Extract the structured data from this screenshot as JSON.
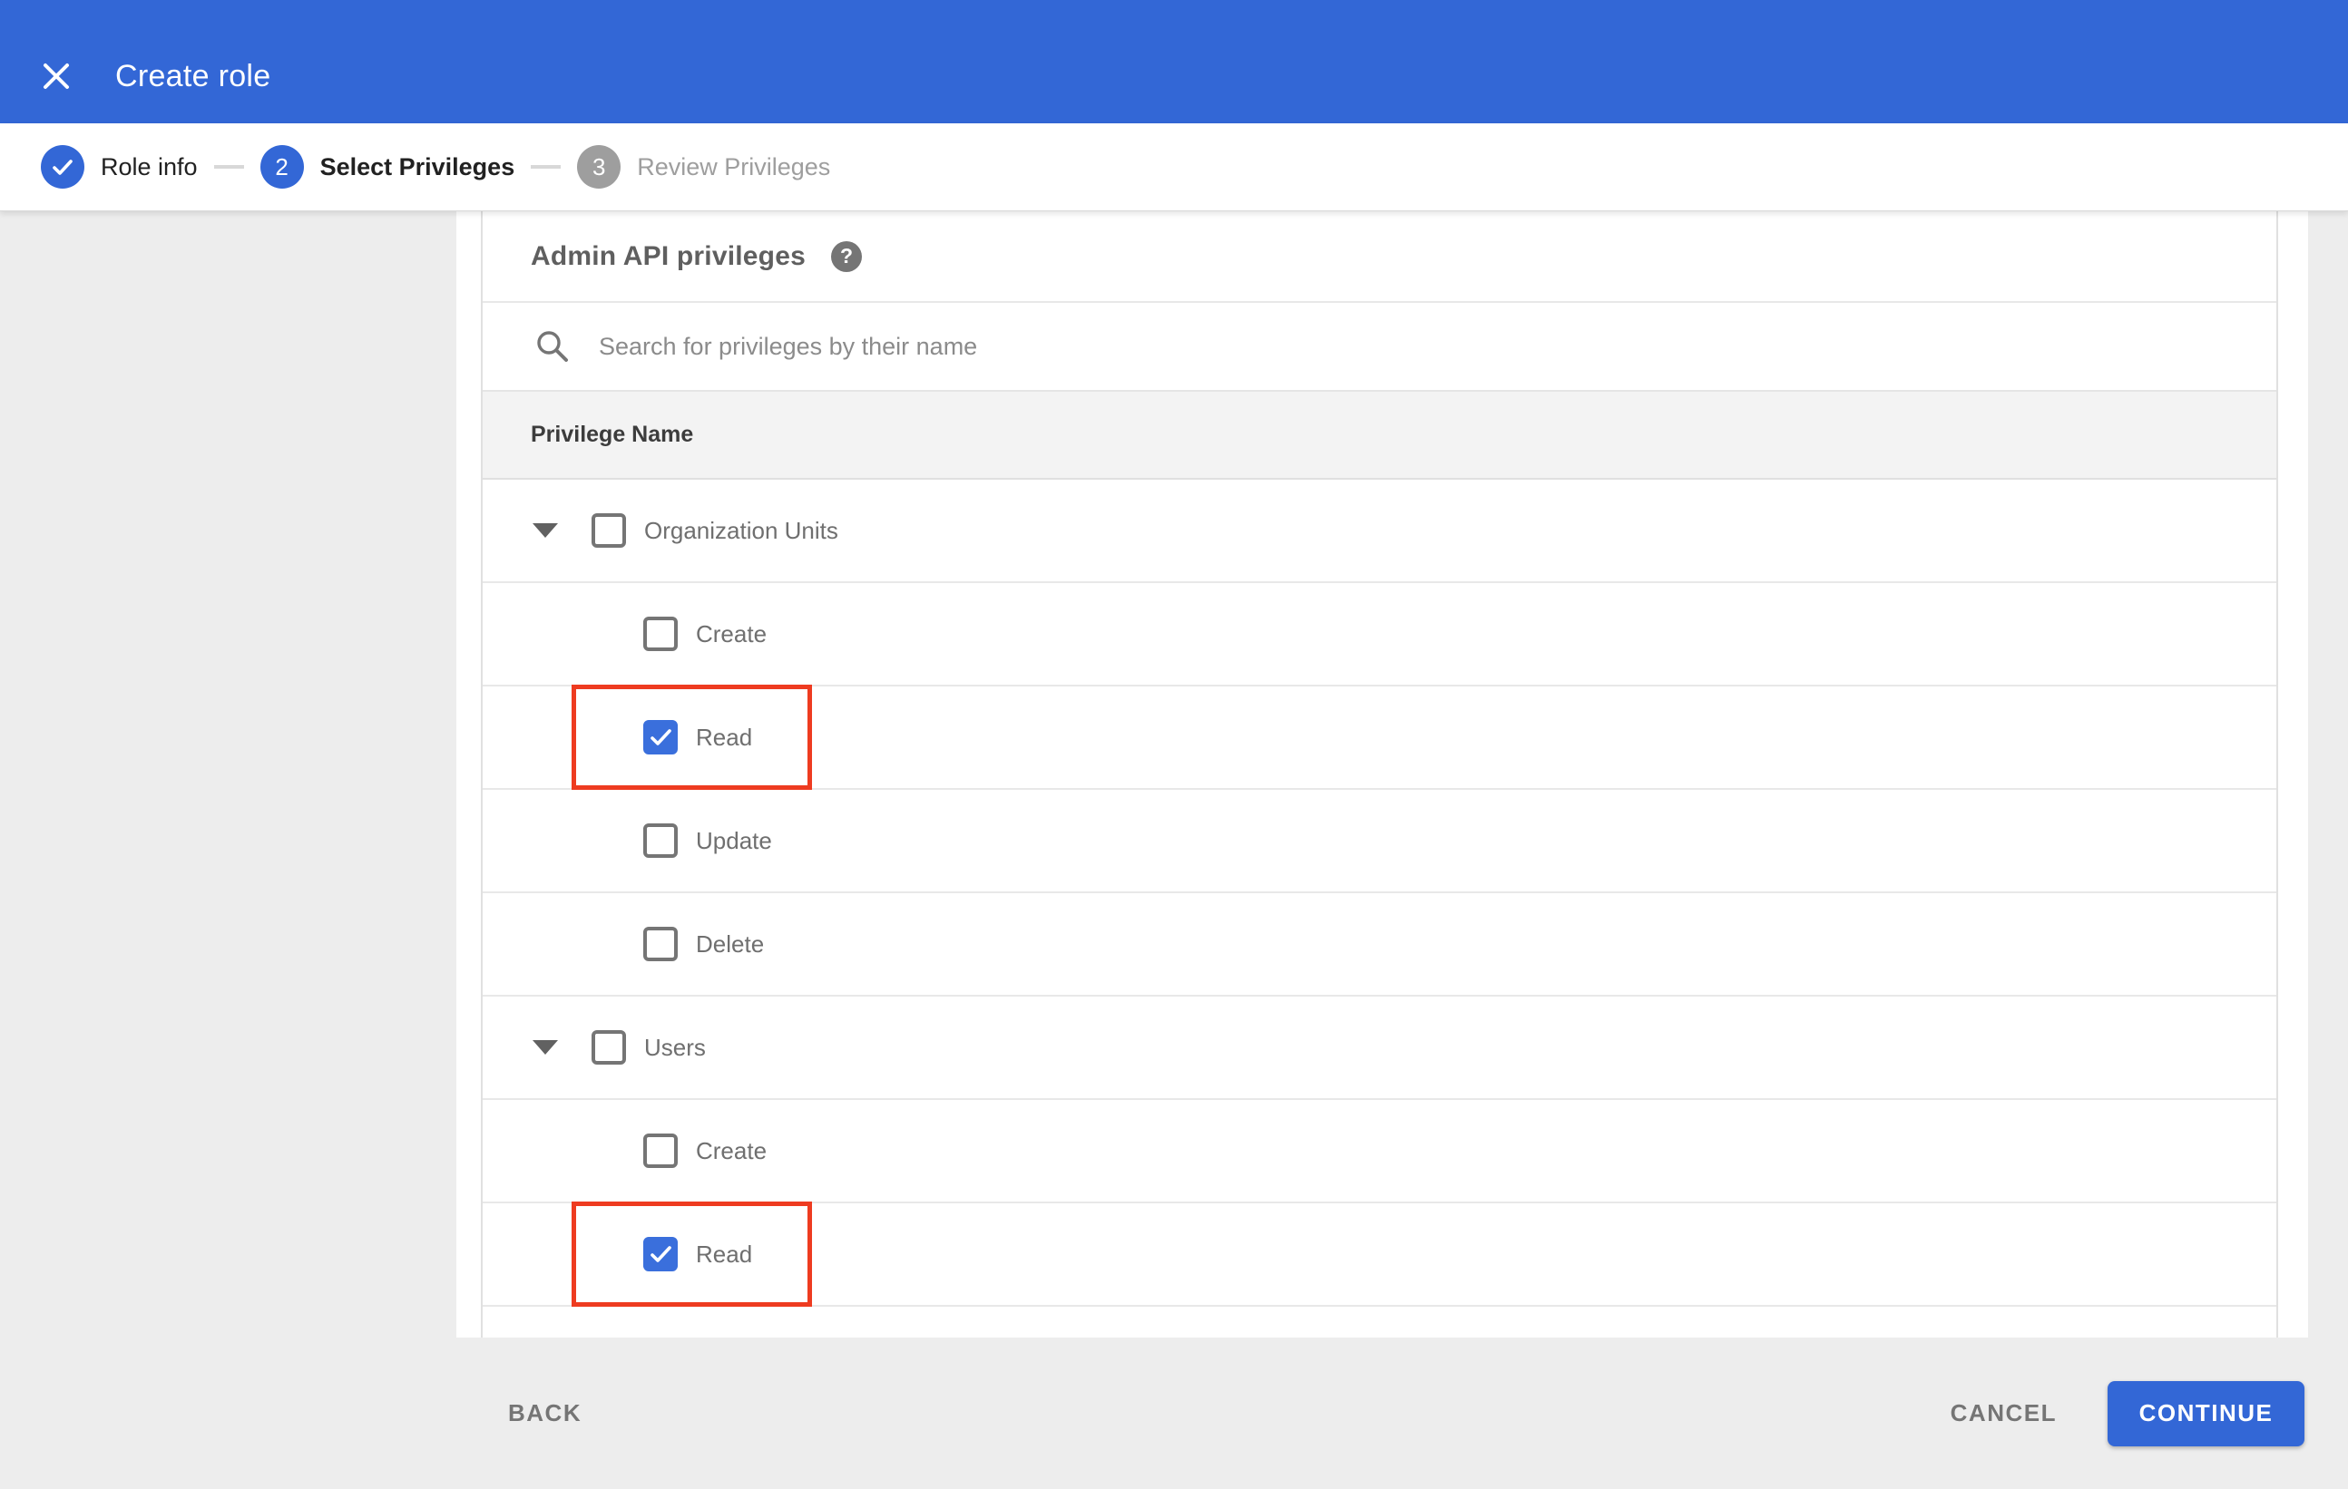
{
  "colors": {
    "appbar_blue": "#3367d6",
    "checkbox_blue": "#3a6fdc",
    "annotation_red": "#ee3b20",
    "page_gray": "#ededed",
    "step_inactive_gray": "#9e9e9e"
  },
  "header": {
    "title": "Create role"
  },
  "stepper": {
    "steps": [
      {
        "label": "Role info",
        "state": "done",
        "number": "1"
      },
      {
        "label": "Select Privileges",
        "state": "active",
        "number": "2"
      },
      {
        "label": "Review Privileges",
        "state": "upcoming",
        "number": "3"
      }
    ]
  },
  "content": {
    "heading": "Admin API privileges",
    "help_glyph": "?",
    "search_placeholder": "Search for privileges by their name",
    "column_header": "Privilege Name",
    "rows": [
      {
        "label": "Organization Units",
        "level": "parent",
        "expanded": true,
        "checked": false,
        "annotated": false
      },
      {
        "label": "Create",
        "level": "child",
        "checked": false,
        "annotated": false
      },
      {
        "label": "Read",
        "level": "child",
        "checked": true,
        "annotated": true
      },
      {
        "label": "Update",
        "level": "child",
        "checked": false,
        "annotated": false
      },
      {
        "label": "Delete",
        "level": "child",
        "checked": false,
        "annotated": false
      },
      {
        "label": "Users",
        "level": "parent",
        "expanded": true,
        "checked": false,
        "annotated": false
      },
      {
        "label": "Create",
        "level": "child",
        "checked": false,
        "annotated": false
      },
      {
        "label": "Read",
        "level": "child",
        "checked": true,
        "annotated": true
      },
      {
        "label": "",
        "level": "spacer",
        "checked": false,
        "annotated": false
      }
    ]
  },
  "footer": {
    "back_label": "BACK",
    "cancel_label": "CANCEL",
    "continue_label": "CONTINUE"
  }
}
